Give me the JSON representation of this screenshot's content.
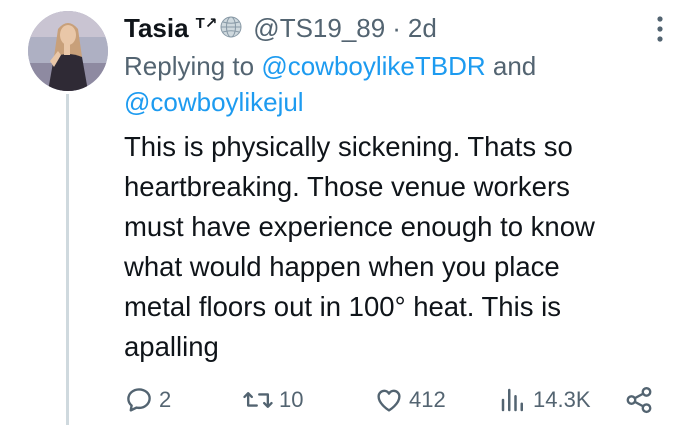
{
  "tweet": {
    "author": {
      "display_name": "Tasia",
      "name_glyph": "T↗",
      "handle": "@TS19_89",
      "timestamp": "2d"
    },
    "reply_context": {
      "prefix": "Replying to",
      "mentions": [
        "@cowboylikeTBDR",
        "@cowboylikejul"
      ],
      "conjunction": "and"
    },
    "text": "This is physically sickening. Thats so\nheartbreaking. Those venue workers\nmust have experience enough to know\nwhat would happen when you place\nmetal floors out in 100° heat. This is\napalling",
    "actions": {
      "replies": "2",
      "reposts": "10",
      "likes": "412",
      "views": "14.3K"
    },
    "icons": {
      "more": "more-vertical-icon",
      "reply": "reply-icon",
      "repost": "repost-icon",
      "like": "heart-icon",
      "views": "views-chart-icon",
      "share": "share-icon",
      "globe": "globe-icon"
    },
    "colors": {
      "text": "#0f1419",
      "secondary": "#536471",
      "mention": "#1d9bf0",
      "thread_line": "#cfd9de"
    }
  }
}
